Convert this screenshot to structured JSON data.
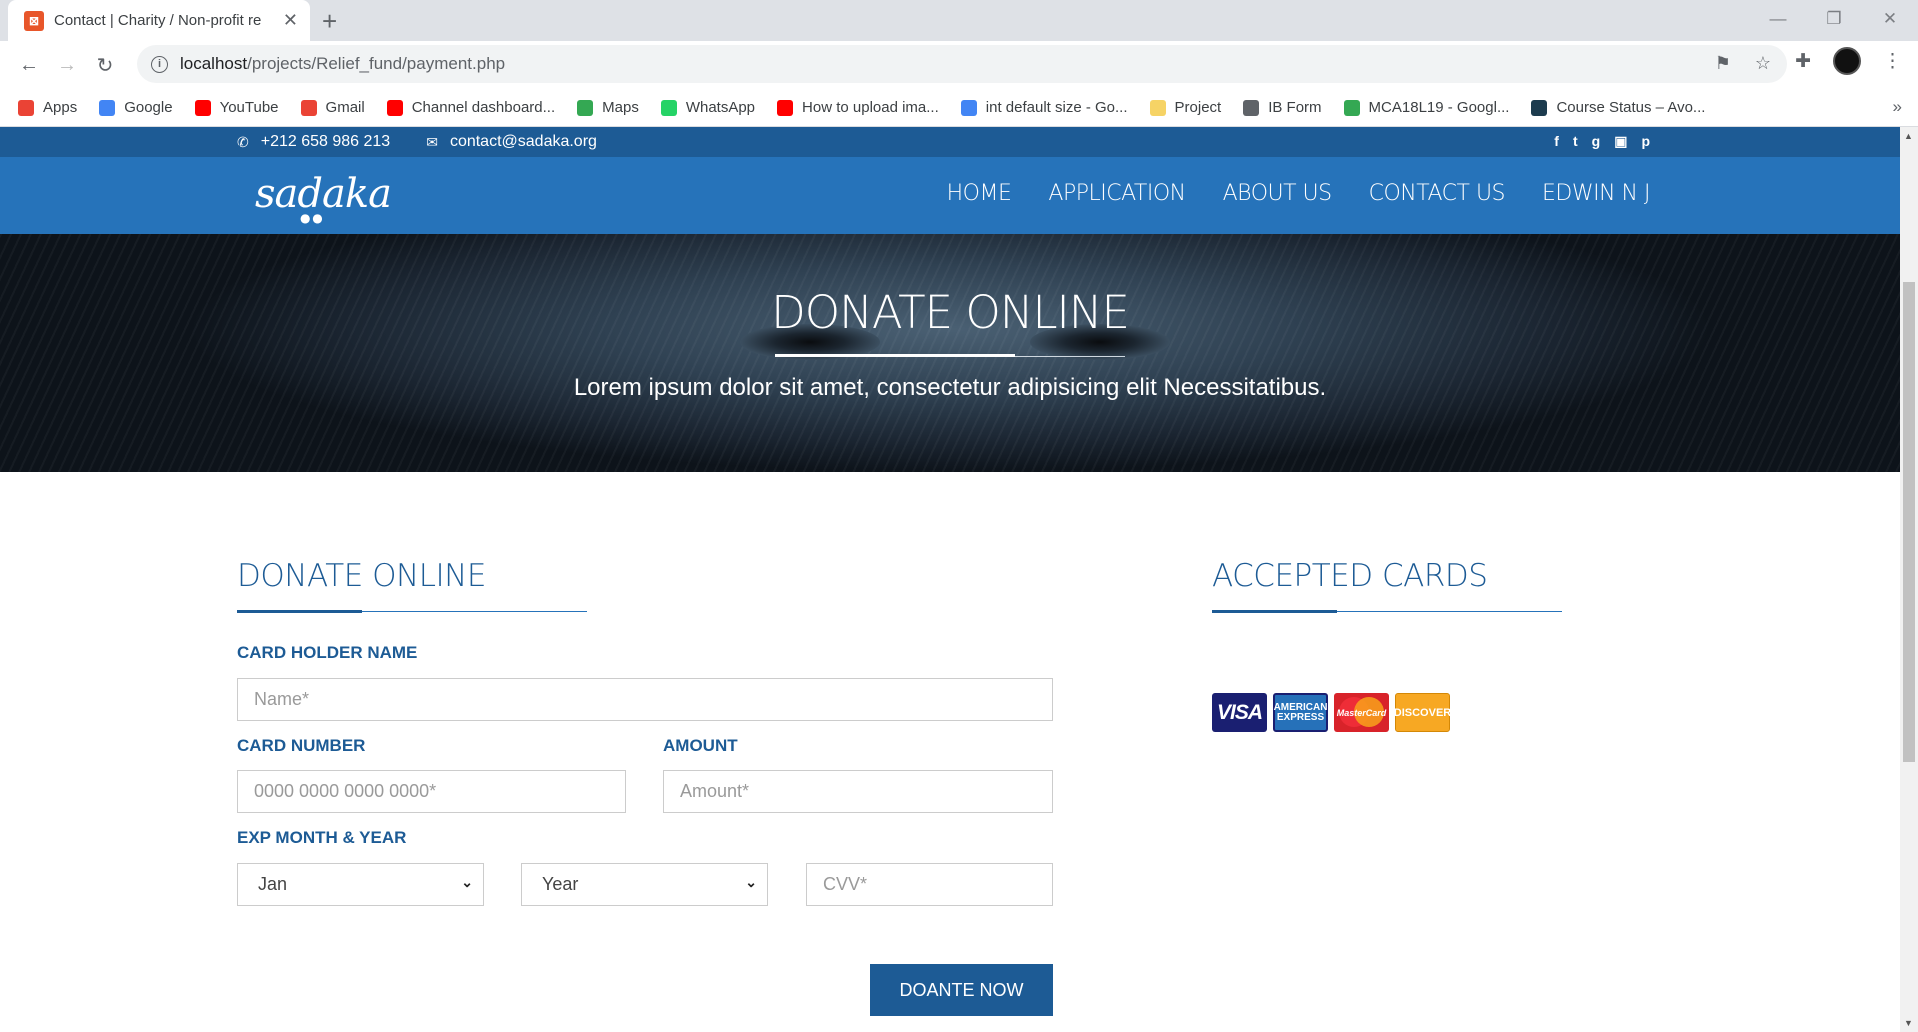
{
  "browser": {
    "tab_title": "Contact | Charity / Non-profit re",
    "url_host": "localhost",
    "url_path": "/projects/Relief_fund/payment.php",
    "bookmarks": [
      {
        "label": "Apps",
        "color": "#ea4335"
      },
      {
        "label": "Google",
        "color": "#4285f4"
      },
      {
        "label": "YouTube",
        "color": "#ff0000"
      },
      {
        "label": "Gmail",
        "color": "#ea4335"
      },
      {
        "label": "Channel dashboard...",
        "color": "#ff0000"
      },
      {
        "label": "Maps",
        "color": "#34a853"
      },
      {
        "label": "WhatsApp",
        "color": "#25d366"
      },
      {
        "label": "How to upload ima...",
        "color": "#ff0000"
      },
      {
        "label": "int default size - Go...",
        "color": "#4285f4"
      },
      {
        "label": "Project",
        "color": "#f6d365"
      },
      {
        "label": "IB Form",
        "color": "#5f6368"
      },
      {
        "label": "MCA18L19 - Googl...",
        "color": "#34a853"
      },
      {
        "label": "Course Status – Avo...",
        "color": "#1c3b4e"
      }
    ]
  },
  "topbar": {
    "phone": "+212 658 986 213",
    "email": "contact@sadaka.org"
  },
  "nav": {
    "logo": "sadaka",
    "items": [
      "HOME",
      "APPLICATION",
      "ABOUT US",
      "CONTACT US",
      "EDWIN N J"
    ]
  },
  "hero": {
    "title": "DONATE ONLINE",
    "subtitle": "Lorem ipsum dolor sit amet, consectetur adipisicing elit Necessitatibus."
  },
  "form": {
    "title": "DONATE ONLINE",
    "card_holder_label": "CARD HOLDER NAME",
    "card_holder_placeholder": "Name*",
    "card_number_label": "CARD NUMBER",
    "card_number_placeholder": "0000 0000 0000 0000*",
    "amount_label": "AMOUNT",
    "amount_placeholder": "Amount*",
    "exp_label": "EXP MONTH & YEAR",
    "month_value": "Jan",
    "year_value": "Year",
    "cvv_placeholder": "CVV*",
    "submit_label": "DOANTE NOW"
  },
  "cards_section": {
    "title": "ACCEPTED CARDS",
    "cards": [
      "VISA",
      "AMERICAN EXPRESS",
      "MasterCard",
      "DISCOVER"
    ]
  }
}
